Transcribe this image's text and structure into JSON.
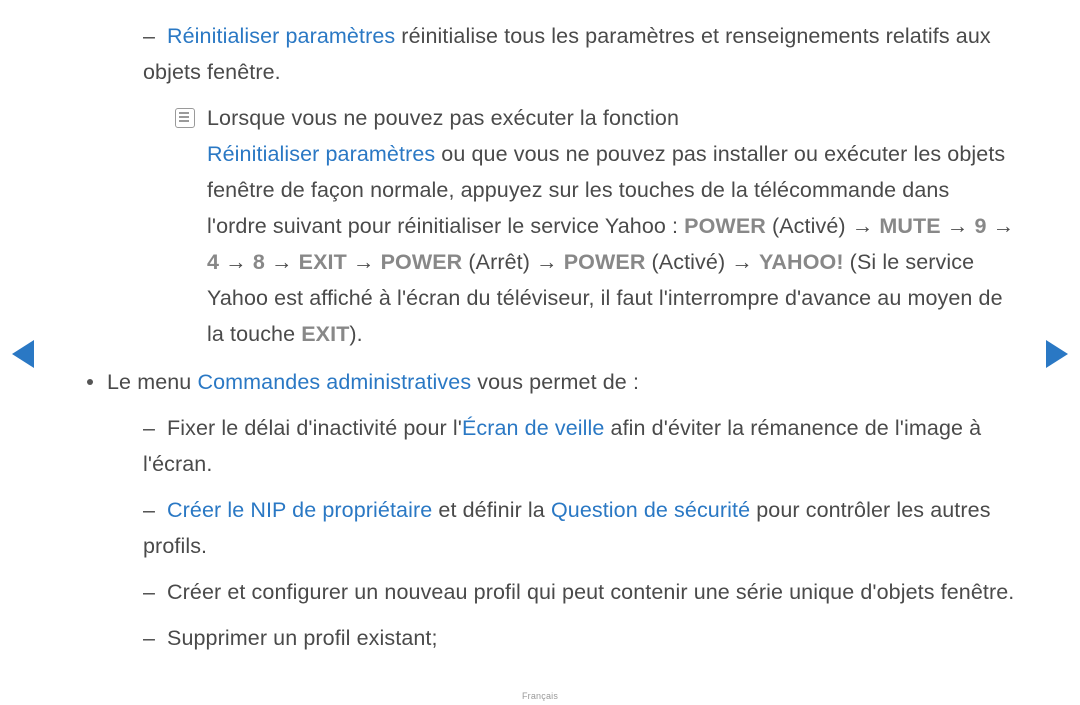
{
  "section1": {
    "reset_label": "Réinitialiser paramètres",
    "reset_tail": " réinitialise tous les paramètres et renseignements relatifs aux objets fenêtre."
  },
  "note": {
    "l1": "Lorsque vous ne pouvez pas exécuter la fonction ",
    "l2a": "Réinitialiser paramètres",
    "l2b": " ou que vous ne pouvez pas installer ou exécuter les objets fenêtre de façon normale, appuyez sur les touches de la télécommande dans l'ordre suivant pour réinitialiser le service Yahoo : ",
    "seq": {
      "power1": "POWER",
      "on1": " (Activé) → ",
      "mute": "MUTE",
      "arr1": " → ",
      "n9": "9",
      "arr2": " → ",
      "n4": "4",
      "arr3": " → ",
      "n8": "8",
      "arr4": " → ",
      "exit": "EXIT",
      "arr5": " → ",
      "power2": "POWER",
      "off": " (Arrêt) → ",
      "power3": "POWER",
      "on2": " (Activé) → ",
      "yahoo": "YAHOO!"
    },
    "tail1": " (Si le service Yahoo est affiché à l'écran du téléviseur, il faut l'interrompre d'avance au moyen de la touche ",
    "exit2": "EXIT",
    "tail2": ")."
  },
  "admin": {
    "pre": "Le menu ",
    "label": "Commandes administratives",
    "post": " vous permet de :"
  },
  "admin_items": {
    "a_pre": "Fixer le délai d'inactivité pour l'",
    "a_blue": "Écran de veille",
    "a_post": " afin d'éviter la rémanence de l'image à l'écran.",
    "b_blue1": "Créer le NIP de propriétaire",
    "b_mid": " et définir la ",
    "b_blue2": "Question de sécurité",
    "b_post": " pour contrôler les autres profils.",
    "c": "Créer et configurer un nouveau profil qui peut contenir une série unique d'objets fenêtre.",
    "d": "Supprimer un profil existant;"
  },
  "footer": "Français"
}
